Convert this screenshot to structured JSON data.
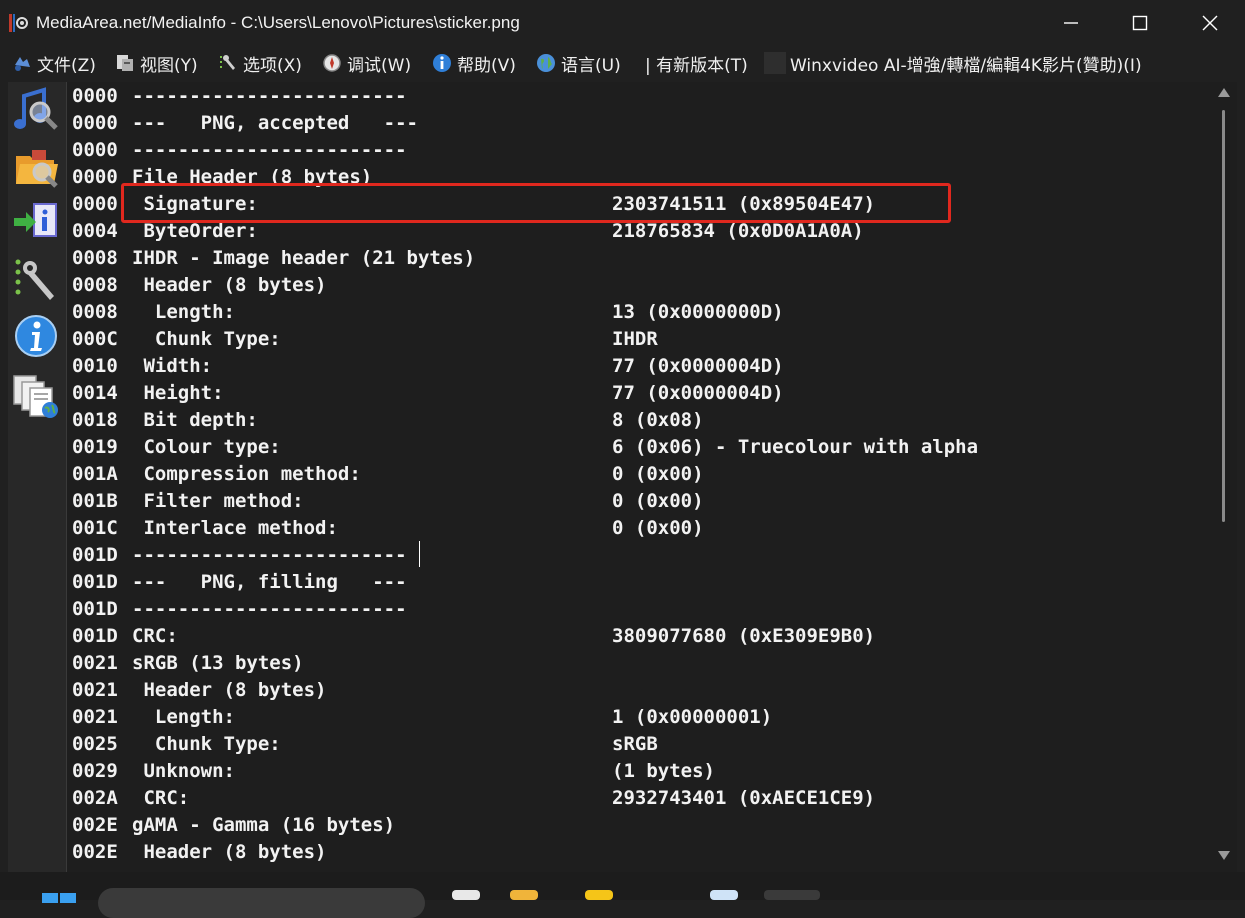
{
  "window": {
    "title": "MediaArea.net/MediaInfo - C:\\Users\\Lenovo\\Pictures\\sticker.png",
    "icon": "mediainfo-app-icon"
  },
  "menu": {
    "items": [
      {
        "label": "文件(Z)",
        "icon": "file-icon"
      },
      {
        "label": "视图(Y)",
        "icon": "view-icon"
      },
      {
        "label": "选项(X)",
        "icon": "options-icon"
      },
      {
        "label": "调试(W)",
        "icon": "debug-icon"
      },
      {
        "label": "帮助(V)",
        "icon": "help-icon"
      },
      {
        "label": "语言(U)",
        "icon": "globe-icon"
      }
    ],
    "new_version": "| 有新版本(T)",
    "sponsor": "Winxvideo AI-增強/轉檔/編輯4K影片(贊助)(I)"
  },
  "sidebar": {
    "buttons": [
      "open-file-icon",
      "open-folder-icon",
      "export-icon",
      "preferences-icon",
      "about-icon",
      "report-icon"
    ]
  },
  "report": {
    "lines": [
      {
        "offset": "0000",
        "label": "------------------------",
        "value": ""
      },
      {
        "offset": "0000",
        "label": "---   PNG, accepted   ---",
        "value": ""
      },
      {
        "offset": "0000",
        "label": "------------------------",
        "value": ""
      },
      {
        "offset": "0000",
        "label": "File Header (8 bytes)",
        "value": ""
      },
      {
        "offset": "0000",
        "label": " Signature:",
        "value": "2303741511 (0x89504E47)"
      },
      {
        "offset": "0004",
        "label": " ByteOrder:",
        "value": "218765834 (0x0D0A1A0A)"
      },
      {
        "offset": "0008",
        "label": "IHDR - Image header (21 bytes)",
        "value": ""
      },
      {
        "offset": "0008",
        "label": " Header (8 bytes)",
        "value": ""
      },
      {
        "offset": "0008",
        "label": "  Length:",
        "value": "13 (0x0000000D)"
      },
      {
        "offset": "000C",
        "label": "  Chunk Type:",
        "value": "IHDR"
      },
      {
        "offset": "0010",
        "label": " Width:",
        "value": "77 (0x0000004D)"
      },
      {
        "offset": "0014",
        "label": " Height:",
        "value": "77 (0x0000004D)"
      },
      {
        "offset": "0018",
        "label": " Bit depth:",
        "value": "8 (0x08)"
      },
      {
        "offset": "0019",
        "label": " Colour type:",
        "value": "6 (0x06) - Truecolour with alpha"
      },
      {
        "offset": "001A",
        "label": " Compression method:",
        "value": "0 (0x00)"
      },
      {
        "offset": "001B",
        "label": " Filter method:",
        "value": "0 (0x00)"
      },
      {
        "offset": "001C",
        "label": " Interlace method:",
        "value": "0 (0x00)"
      },
      {
        "offset": "001D",
        "label": "------------------------",
        "value": ""
      },
      {
        "offset": "001D",
        "label": "---   PNG, filling   ---",
        "value": ""
      },
      {
        "offset": "001D",
        "label": "------------------------",
        "value": ""
      },
      {
        "offset": "001D",
        "label": "CRC:",
        "value": "3809077680 (0xE309E9B0)"
      },
      {
        "offset": "0021",
        "label": "sRGB (13 bytes)",
        "value": ""
      },
      {
        "offset": "0021",
        "label": " Header (8 bytes)",
        "value": ""
      },
      {
        "offset": "0021",
        "label": "  Length:",
        "value": "1 (0x00000001)"
      },
      {
        "offset": "0025",
        "label": "  Chunk Type:",
        "value": "sRGB"
      },
      {
        "offset": "0029",
        "label": " Unknown:",
        "value": "(1 bytes)"
      },
      {
        "offset": "002A",
        "label": " CRC:",
        "value": "2932743401 (0xAECE1CE9)"
      },
      {
        "offset": "002E",
        "label": "gAMA - Gamma (16 bytes)",
        "value": ""
      },
      {
        "offset": "002E",
        "label": " Header (8 bytes)",
        "value": ""
      }
    ]
  },
  "colors": {
    "background": "#202020",
    "text": "#f2f2f2",
    "highlight_border": "#e0281e"
  }
}
